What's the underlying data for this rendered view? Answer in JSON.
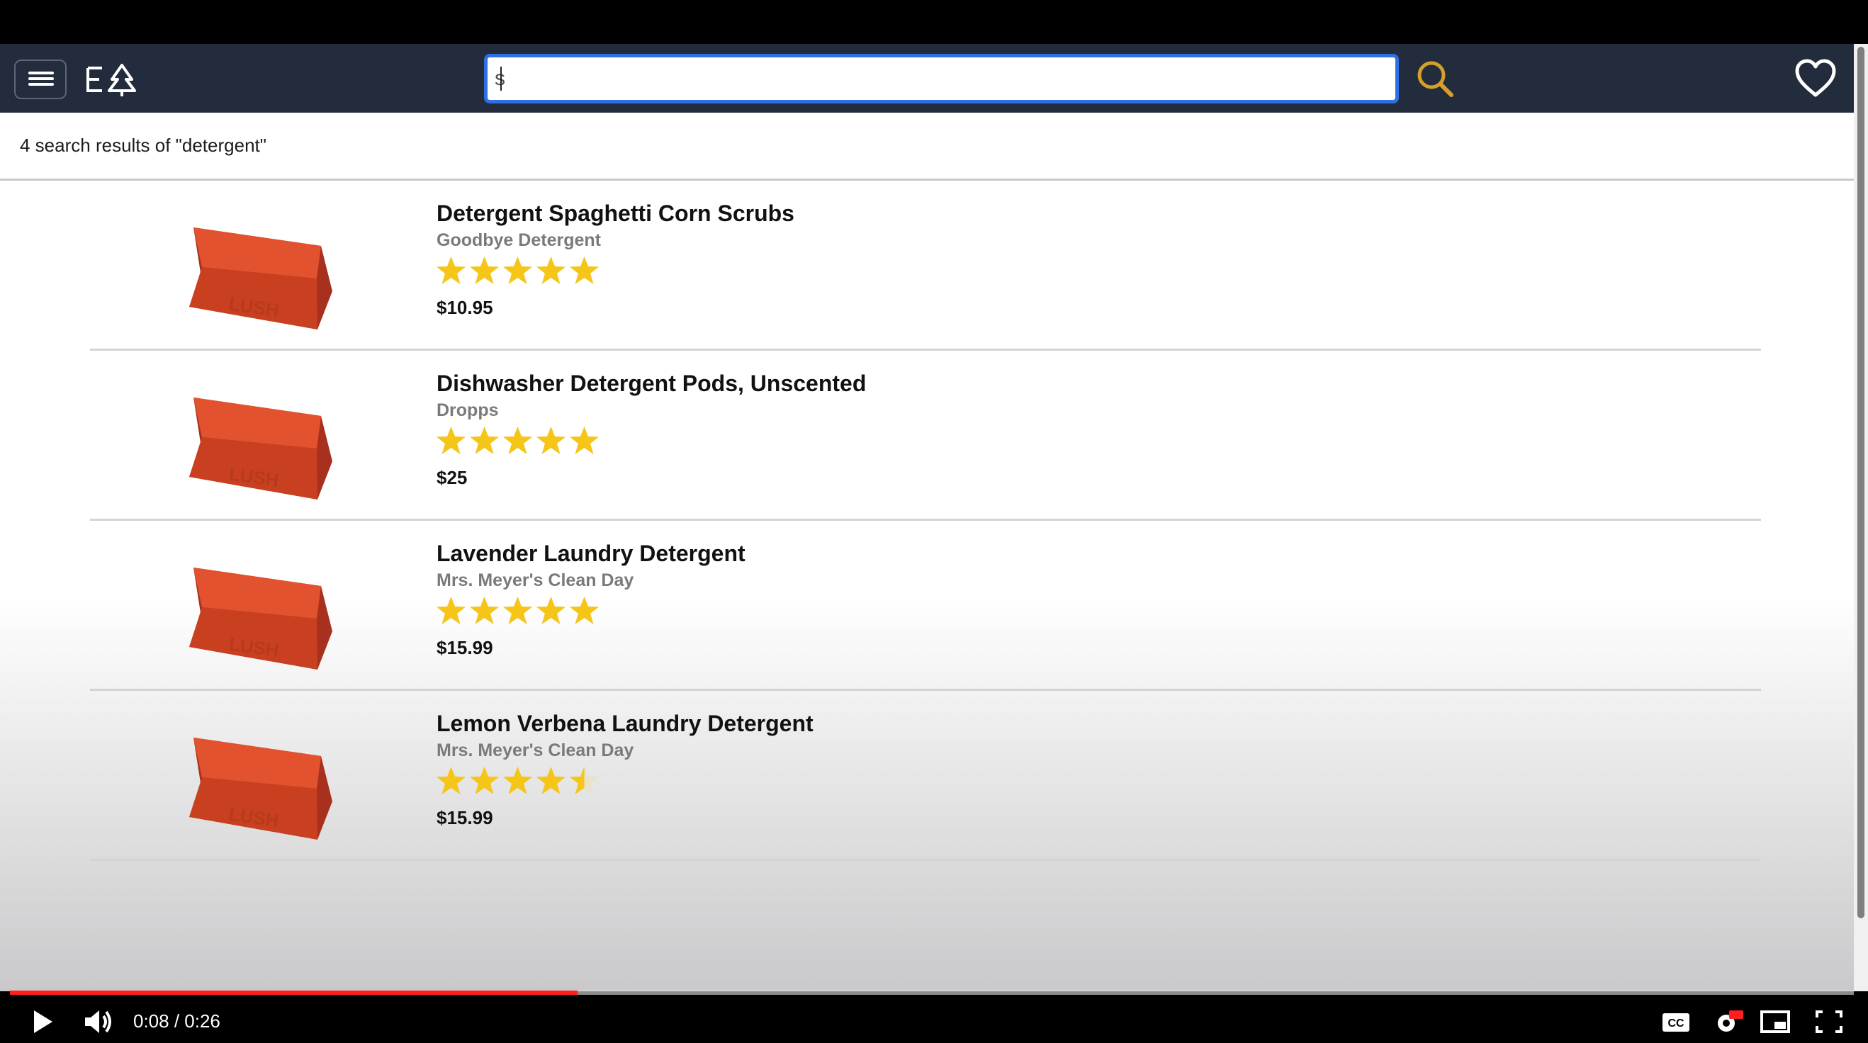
{
  "search": {
    "value": "s",
    "placeholder": ""
  },
  "results": {
    "summary": "4 search results of \"detergent\""
  },
  "products": [
    {
      "name": "Detergent Spaghetti Corn Scrubs",
      "brand": "Goodbye Detergent",
      "rating": 5,
      "price": "$10.95"
    },
    {
      "name": "Dishwasher Detergent Pods, Unscented",
      "brand": "Dropps",
      "rating": 5,
      "price": "$25"
    },
    {
      "name": "Lavender Laundry Detergent",
      "brand": "Mrs. Meyer's Clean Day",
      "rating": 5,
      "price": "$15.99"
    },
    {
      "name": "Lemon Verbena Laundry Detergent",
      "brand": "Mrs. Meyer's Clean Day",
      "rating": 4.5,
      "price": "$15.99"
    }
  ],
  "video": {
    "time": "0:08 / 0:26",
    "progress": 0.308
  },
  "colors": {
    "header": "#222c3c",
    "accent_search": "#2f6fe4",
    "search_icon": "#d4a02a",
    "star": "#f5c518",
    "progress": "#ff1f1f"
  },
  "icons": {
    "menu": "hamburger-icon",
    "logo": "tree-logo-icon",
    "search": "magnifier-icon",
    "favorites": "heart-icon"
  }
}
